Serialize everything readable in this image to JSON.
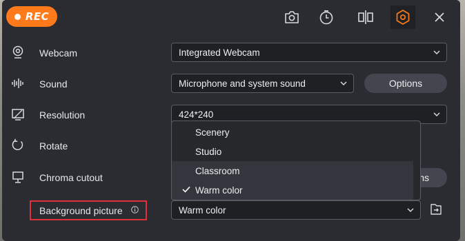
{
  "header": {
    "rec_label": "REC",
    "icons": [
      "camera-icon",
      "timer-icon",
      "split-icon",
      "settings-hex-icon",
      "close-icon"
    ]
  },
  "rows": {
    "webcam": {
      "label": "Webcam",
      "value": "Integrated Webcam"
    },
    "sound": {
      "label": "Sound",
      "value": "Microphone and system sound",
      "options_label": "Options"
    },
    "resolution": {
      "label": "Resolution",
      "value": "424*240"
    },
    "rotate": {
      "label": "Rotate"
    },
    "chroma": {
      "label": "Chroma cutout",
      "button_partial": "ns"
    },
    "background": {
      "label": "Background picture",
      "value": "Warm color"
    }
  },
  "dropdown": {
    "items": [
      {
        "label": "Scenery",
        "checked": false
      },
      {
        "label": "Studio",
        "checked": false
      },
      {
        "label": "Classroom",
        "checked": false
      },
      {
        "label": "Warm color",
        "checked": true
      }
    ]
  },
  "colors": {
    "accent": "#ff7a1a",
    "highlight": "#e0303a",
    "panel": "#2a2c31"
  }
}
